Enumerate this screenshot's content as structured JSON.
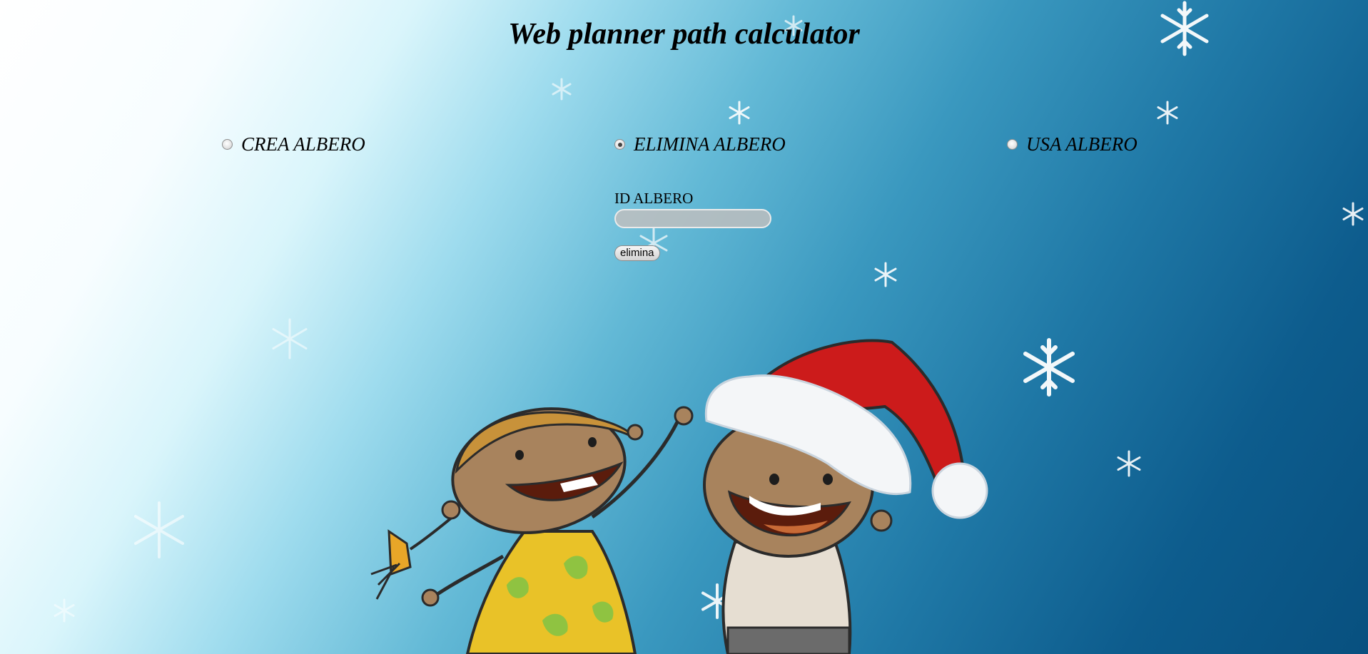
{
  "page": {
    "title": "Web planner path calculator"
  },
  "modes": [
    {
      "label": "CREA ALBERO",
      "selected": false
    },
    {
      "label": "ELIMINA ALBERO",
      "selected": true
    },
    {
      "label": "USA ALBERO",
      "selected": false
    }
  ],
  "form": {
    "id_label": "ID ALBERO",
    "id_value": "",
    "delete_button": "elimina"
  },
  "colors": {
    "background_light": "#ffffff",
    "background_dark": "#08507f",
    "hat_red": "#cc1b1b",
    "dress_yellow": "#e9c228"
  }
}
